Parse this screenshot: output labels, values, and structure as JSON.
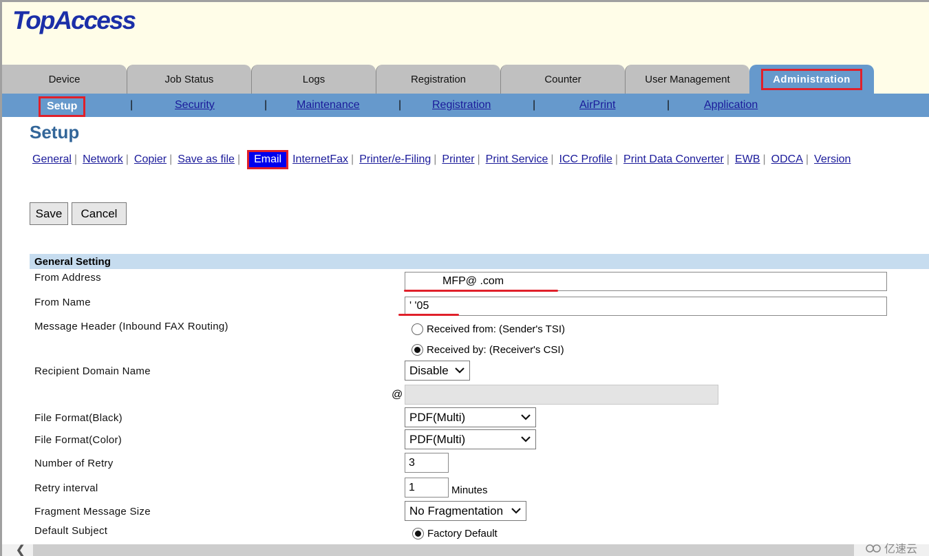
{
  "app": {
    "logo": "TopAccess"
  },
  "tabs": [
    {
      "label": "Device"
    },
    {
      "label": "Job Status"
    },
    {
      "label": "Logs"
    },
    {
      "label": "Registration"
    },
    {
      "label": "Counter"
    },
    {
      "label": "User Management"
    },
    {
      "label": "Administration",
      "active": true
    }
  ],
  "subnav": {
    "current": "Setup",
    "items": [
      "Security",
      "Maintenance",
      "Registration",
      "AirPrint",
      "Application"
    ],
    "separator": "|"
  },
  "page": {
    "title": "Setup",
    "links": [
      "General",
      "Network",
      "Copier",
      "Save as file",
      "Email",
      "InternetFax",
      "Printer/e-Filing",
      "Printer",
      "Print Service",
      "ICC Profile",
      "Print Data Converter",
      "EWB",
      "ODCA",
      "Version"
    ],
    "active_link": "Email"
  },
  "actions": {
    "save_label": "Save",
    "cancel_label": "Cancel"
  },
  "general_setting": {
    "header": "General Setting",
    "from_address": {
      "label": "From Address",
      "value": "MFP@        .com"
    },
    "from_name": {
      "label": "From Name",
      "value": "'        '05"
    },
    "message_header": {
      "label": "Message Header (Inbound FAX Routing)",
      "options": [
        {
          "label": "Received from: (Sender's TSI)",
          "selected": false
        },
        {
          "label": "Received by: (Receiver's CSI)",
          "selected": true
        }
      ]
    },
    "recipient_domain": {
      "label": "Recipient Domain Name",
      "value": "Disable",
      "at_symbol": "@",
      "domain_value": ""
    },
    "file_format_black": {
      "label": "File Format(Black)",
      "value": "PDF(Multi)"
    },
    "file_format_color": {
      "label": "File Format(Color)",
      "value": "PDF(Multi)"
    },
    "number_of_retry": {
      "label": "Number of Retry",
      "value": "3"
    },
    "retry_interval": {
      "label": "Retry interval",
      "value": "1",
      "unit": "Minutes"
    },
    "fragment_size": {
      "label": "Fragment Message Size",
      "value": "No Fragmentation"
    },
    "default_subject": {
      "label": "Default Subject",
      "option": "Factory Default",
      "selected": true
    }
  },
  "watermark": {
    "text": "亿速云"
  },
  "colors": {
    "accent_blue": "#6699cc",
    "highlight_red": "#e0202a",
    "header_bg": "#fffde8",
    "section_bg": "#c6dcef",
    "title_blue": "#336699"
  }
}
